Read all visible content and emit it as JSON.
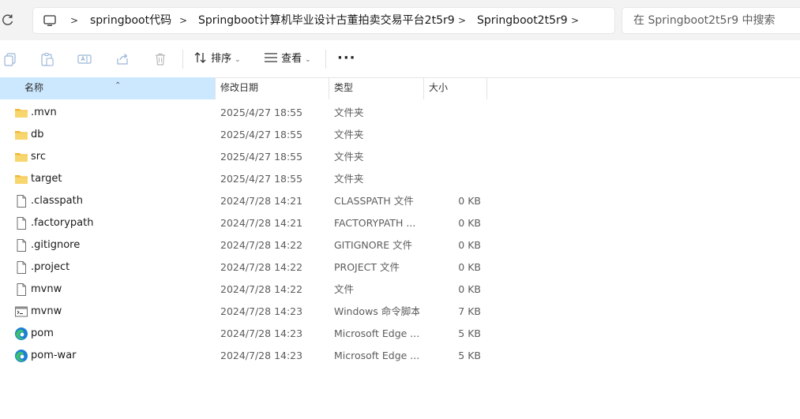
{
  "address": {
    "breadcrumbs": [
      "springboot代码",
      "Springboot计算机毕业设计古董拍卖交易平台2t5r9",
      "Springboot2t5r9"
    ],
    "search_placeholder": "在 Springboot2t5r9 中搜索"
  },
  "toolbar": {
    "sort_label": "排序",
    "view_label": "查看",
    "more_label": "···"
  },
  "columns": {
    "name": "名称",
    "date": "修改日期",
    "type": "类型",
    "size": "大小"
  },
  "files": [
    {
      "name": ".mvn",
      "date": "2025/4/27 18:55",
      "type": "文件夹",
      "size": "",
      "icon": "folder-icon"
    },
    {
      "name": "db",
      "date": "2025/4/27 18:55",
      "type": "文件夹",
      "size": "",
      "icon": "folder-icon"
    },
    {
      "name": "src",
      "date": "2025/4/27 18:55",
      "type": "文件夹",
      "size": "",
      "icon": "folder-icon"
    },
    {
      "name": "target",
      "date": "2025/4/27 18:55",
      "type": "文件夹",
      "size": "",
      "icon": "folder-icon"
    },
    {
      "name": ".classpath",
      "date": "2024/7/28 14:21",
      "type": "CLASSPATH 文件",
      "size": "0 KB",
      "icon": "file-icon"
    },
    {
      "name": ".factorypath",
      "date": "2024/7/28 14:21",
      "type": "FACTORYPATH ...",
      "size": "0 KB",
      "icon": "file-icon"
    },
    {
      "name": ".gitignore",
      "date": "2024/7/28 14:22",
      "type": "GITIGNORE 文件",
      "size": "0 KB",
      "icon": "file-icon"
    },
    {
      "name": ".project",
      "date": "2024/7/28 14:22",
      "type": "PROJECT 文件",
      "size": "0 KB",
      "icon": "file-icon"
    },
    {
      "name": "mvnw",
      "date": "2024/7/28 14:22",
      "type": "文件",
      "size": "0 KB",
      "icon": "file-icon"
    },
    {
      "name": "mvnw",
      "date": "2024/7/28 14:23",
      "type": "Windows 命令脚本",
      "size": "7 KB",
      "icon": "cmd-script-icon"
    },
    {
      "name": "pom",
      "date": "2024/7/28 14:23",
      "type": "Microsoft Edge ...",
      "size": "5 KB",
      "icon": "edge-icon"
    },
    {
      "name": "pom-war",
      "date": "2024/7/28 14:23",
      "type": "Microsoft Edge ...",
      "size": "5 KB",
      "icon": "edge-icon"
    }
  ],
  "colors": {
    "selected_header": "#cce8ff",
    "folder": "#f4c74e",
    "edge_blue": "#1b7fd6",
    "edge_green": "#3ec16b"
  }
}
